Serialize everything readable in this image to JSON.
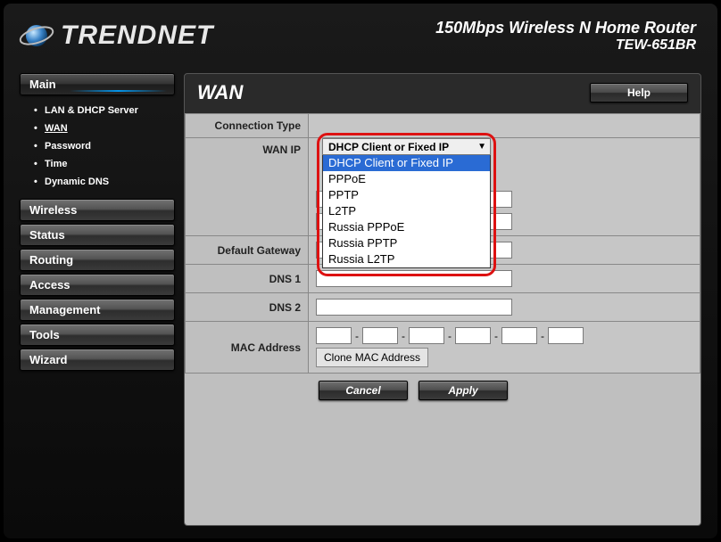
{
  "brand": {
    "name": "TRENDNET"
  },
  "product": {
    "line1": "150Mbps Wireless N Home Router",
    "line2": "TEW-651BR"
  },
  "sidebar": {
    "sections": [
      {
        "label": "Main",
        "active": true
      },
      {
        "label": "Wireless"
      },
      {
        "label": "Status"
      },
      {
        "label": "Routing"
      },
      {
        "label": "Access"
      },
      {
        "label": "Management"
      },
      {
        "label": "Tools"
      },
      {
        "label": "Wizard"
      }
    ],
    "main_items": [
      {
        "label": "LAN & DHCP Server"
      },
      {
        "label": "WAN",
        "current": true
      },
      {
        "label": "Password"
      },
      {
        "label": "Time"
      },
      {
        "label": "Dynamic DNS"
      }
    ]
  },
  "page": {
    "title": "WAN",
    "help": "Help"
  },
  "form": {
    "connection_type_label": "Connection Type",
    "wan_ip_label": "WAN IP",
    "default_gateway_label": "Default Gateway",
    "dns1_label": "DNS 1",
    "dns2_label": "DNS 2",
    "mac_label": "MAC Address",
    "clone_label": "Clone MAC Address",
    "cancel": "Cancel",
    "apply": "Apply",
    "sep": "-"
  },
  "dropdown": {
    "selected": "DHCP Client or Fixed IP",
    "options": [
      "DHCP Client or Fixed IP",
      "PPPoE",
      "PPTP",
      "L2TP",
      "Russia PPPoE",
      "Russia PPTP",
      "Russia L2TP"
    ]
  }
}
